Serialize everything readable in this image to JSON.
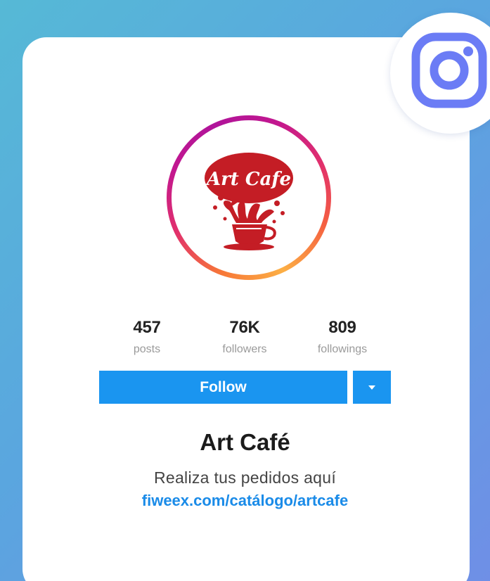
{
  "profile": {
    "name": "Art Café",
    "avatar_text": "Art Cafe",
    "bio": "Realiza tus pedidos aquí",
    "link": "fiweex.com/catálogo/artcafe"
  },
  "stats": [
    {
      "value": "457",
      "label": "posts"
    },
    {
      "value": "76K",
      "label": "followers"
    },
    {
      "value": "809",
      "label": "followings"
    }
  ],
  "actions": {
    "follow_label": "Follow",
    "dropdown_icon": "caret-down-icon"
  },
  "brand": {
    "icon": "instagram-icon",
    "instagram_color": "#6b7cf5",
    "button_color": "#1a95f0",
    "link_color": "#1a8be8",
    "logo_red": "#c41d25"
  }
}
